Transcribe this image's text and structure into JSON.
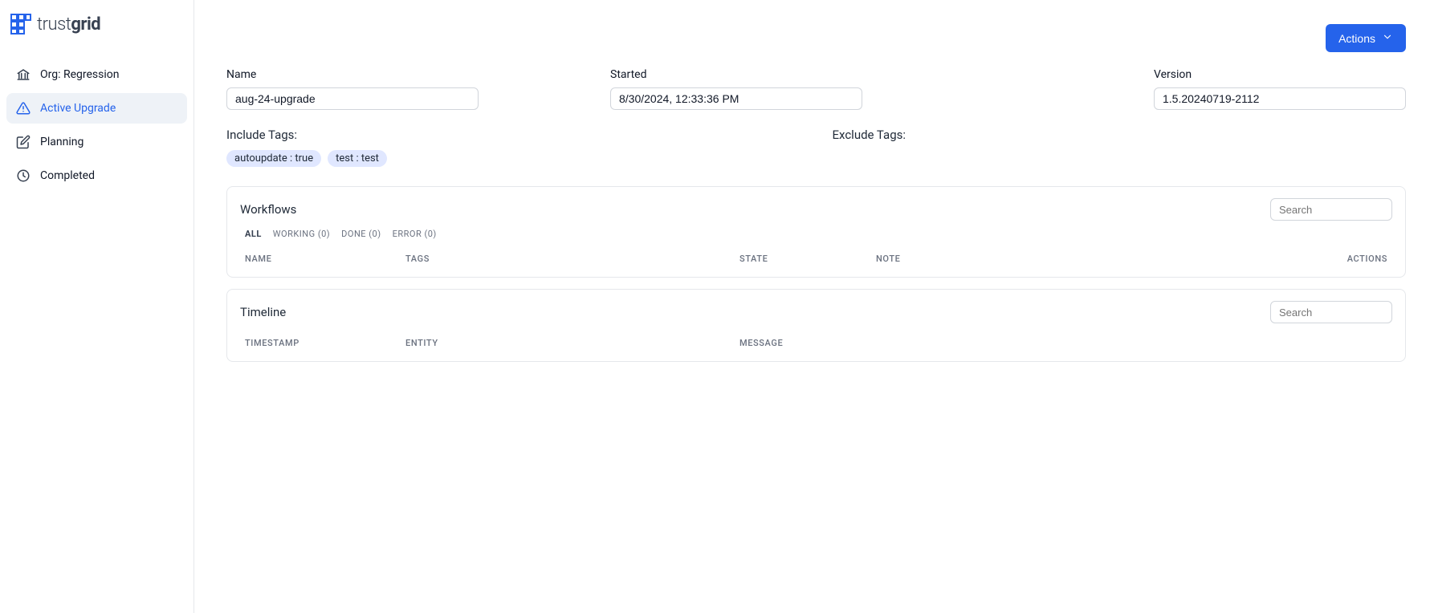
{
  "logo": {
    "text_light": "trust",
    "text_bold": "grid"
  },
  "sidebar": {
    "items": [
      {
        "label": "Org: Regression"
      },
      {
        "label": "Active Upgrade"
      },
      {
        "label": "Planning"
      },
      {
        "label": "Completed"
      }
    ]
  },
  "topbar": {
    "actions_label": "Actions"
  },
  "fields": {
    "name_label": "Name",
    "name_value": "aug-24-upgrade",
    "started_label": "Started",
    "started_value": "8/30/2024, 12:33:36 PM",
    "version_label": "Version",
    "version_value": "1.5.20240719-2112"
  },
  "tags": {
    "include_label": "Include Tags:",
    "exclude_label": "Exclude Tags:",
    "include": [
      "autoupdate : true",
      "test : test"
    ],
    "exclude": []
  },
  "workflows": {
    "title": "Workflows",
    "search_placeholder": "Search",
    "subtabs": [
      {
        "label": "ALL"
      },
      {
        "label": "WORKING (0)"
      },
      {
        "label": "DONE (0)"
      },
      {
        "label": "ERROR (0)"
      }
    ],
    "columns": {
      "name": "NAME",
      "tags": "TAGS",
      "state": "STATE",
      "note": "NOTE",
      "actions": "ACTIONS"
    }
  },
  "timeline": {
    "title": "Timeline",
    "search_placeholder": "Search",
    "columns": {
      "timestamp": "TIMESTAMP",
      "entity": "ENTITY",
      "message": "MESSAGE"
    }
  }
}
